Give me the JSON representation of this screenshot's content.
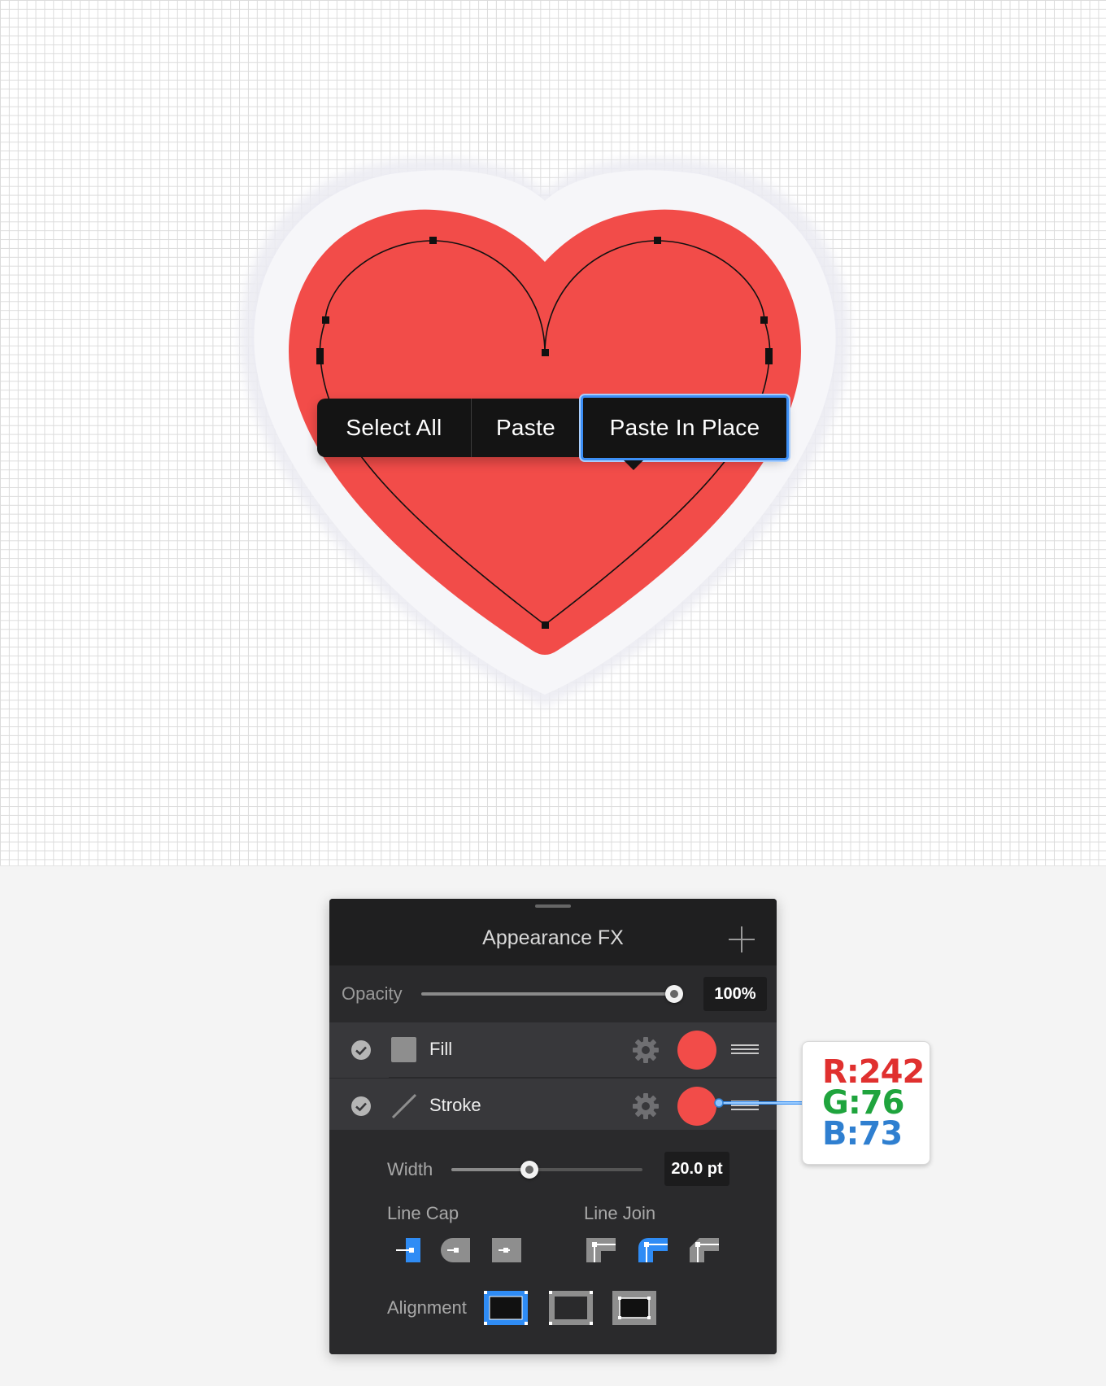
{
  "canvas": {
    "background": "#ffffff",
    "heart_fill": "#f24c49",
    "heart_glow": "#f4f4f8"
  },
  "context_menu": {
    "items": [
      {
        "label": "Select All"
      },
      {
        "label": "Paste"
      },
      {
        "label": "Paste In Place",
        "selected": true
      }
    ],
    "highlight_color": "#3d8ff5"
  },
  "panel": {
    "title": "Appearance FX",
    "add_icon": "plus-icon",
    "opacity": {
      "label": "Opacity",
      "value": "100%",
      "fraction": 1.0
    },
    "layers": [
      {
        "label": "Fill",
        "type_icon": "fill-square-icon",
        "enabled": true,
        "color": "#f24c49"
      },
      {
        "label": "Stroke",
        "type_icon": "stroke-line-icon",
        "enabled": true,
        "color": "#f24c49"
      }
    ],
    "width": {
      "label": "Width",
      "value": "20.0 pt",
      "fraction": 0.4
    },
    "line_cap": {
      "label": "Line Cap",
      "options": [
        "butt-cap-icon",
        "round-cap-icon",
        "projecting-cap-icon"
      ],
      "selected": 0
    },
    "line_join": {
      "label": "Line Join",
      "options": [
        "miter-join-icon",
        "round-join-icon",
        "bevel-join-icon"
      ],
      "selected": 1
    },
    "alignment": {
      "label": "Alignment",
      "options": [
        "align-inside-icon",
        "align-center-icon",
        "align-outside-icon"
      ],
      "selected": 0
    },
    "accent_color": "#2f8cf5"
  },
  "rgb_callout": {
    "r": "R:242",
    "g": "G:76",
    "b": "B:73",
    "r_color": "#e0302f",
    "g_color": "#1fa43d",
    "b_color": "#2f7fd0"
  }
}
